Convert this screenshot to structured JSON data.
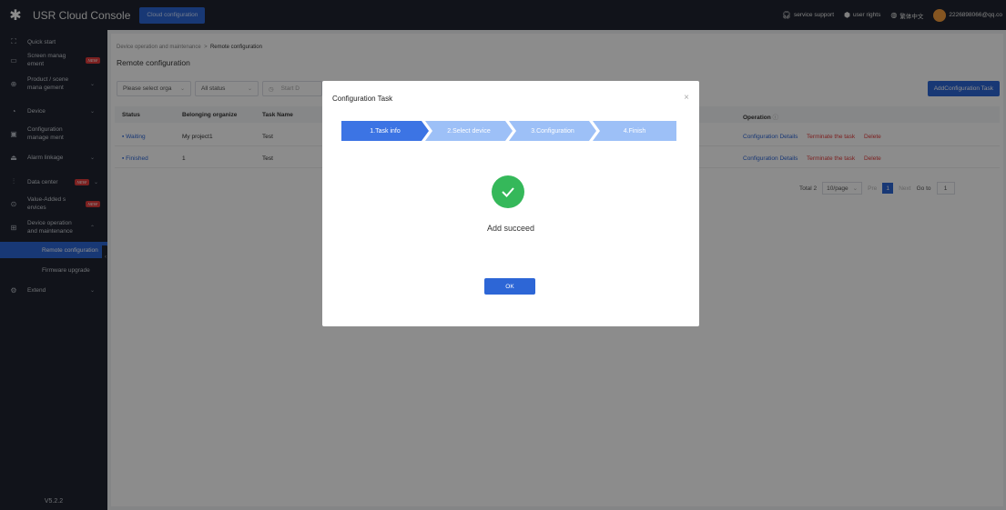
{
  "topbar": {
    "brand": "USR Cloud Console",
    "active_tab": "Cloud configuration",
    "service_support": "service support",
    "user_rights": "user rights",
    "language": "繁体中文",
    "user_email": "2226898066@qq.co"
  },
  "sidebar": {
    "items": [
      {
        "label": "Quick start",
        "icon": "quick-start-icon"
      },
      {
        "label": "Screen manag ement",
        "icon": "screen-icon",
        "badge": "NEW"
      },
      {
        "label": "Product / scene mana gement",
        "icon": "product-icon",
        "arrow": "⌄"
      },
      {
        "label": "Device",
        "icon": "device-icon",
        "arrow": "⌄"
      },
      {
        "label": "Configuration manage ment",
        "icon": "configuration-icon"
      },
      {
        "label": "Alarm linkage",
        "icon": "alarm-icon",
        "arrow": "⌄"
      },
      {
        "label": "Data center",
        "icon": "data-center-icon",
        "badge": "NEW",
        "arrow": "⌄"
      },
      {
        "label": "Value-Added s ervices",
        "icon": "value-added-icon",
        "badge": "NEW"
      },
      {
        "label": "Device operation and maintenance",
        "icon": "maintenance-icon",
        "arrow": "⌃"
      },
      {
        "label": "Extend",
        "icon": "extend-icon",
        "arrow": "⌄"
      }
    ],
    "sub_items": [
      {
        "label": "Remote configuration",
        "active": true
      },
      {
        "label": "Firmware upgrade",
        "active": false
      }
    ],
    "version": "V5.2.2"
  },
  "main": {
    "breadcrumb_parent": "Device operation and maintenance",
    "breadcrumb_sep": ">",
    "breadcrumb_current": "Remote configuration",
    "title": "Remote configuration",
    "filter_org": "Please select orga",
    "filter_status": "All status",
    "filter_start": "Start D",
    "add_button": "AddConfiguration Task",
    "table": {
      "headers": [
        "Status",
        "Belonging organize",
        "Task Name",
        "Operation"
      ],
      "rows": [
        {
          "status": "Waiting",
          "org": "My project1",
          "task": "Test"
        },
        {
          "status": "Finished",
          "org": "1",
          "task": "Test"
        }
      ],
      "op_details": "Configuration Details",
      "op_terminate": "Terminate the task",
      "op_delete": "Delete"
    },
    "pagination": {
      "total": "Total 2",
      "page_size": "10/page",
      "prev": "Pre",
      "current": "1",
      "next": "Next",
      "goto_label": "Go to",
      "goto_value": "1"
    }
  },
  "modal": {
    "title": "Configuration Task",
    "close": "×",
    "steps": [
      "1.Task info",
      "2.Select device",
      "3.Configuration",
      "4.Finish"
    ],
    "message": "Add succeed",
    "ok": "OK"
  },
  "colors": {
    "primary": "#2d66d6",
    "sidebar_bg": "#1f2430",
    "success": "#35b85a",
    "danger": "#e23b3b",
    "step_active": "#3c74e4",
    "step_inactive": "#9dc0f7"
  }
}
